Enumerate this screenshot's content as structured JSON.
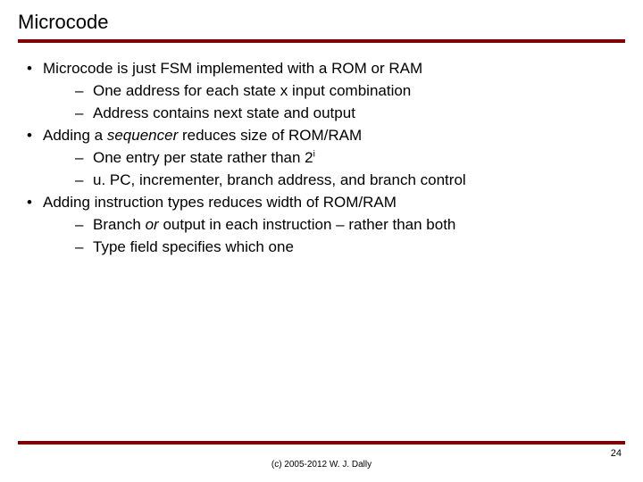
{
  "title": "Microcode",
  "bullets": {
    "b1": "Microcode is just FSM implemented with a ROM or RAM",
    "b1a": "One address for each state x input combination",
    "b1b": "Address contains next state and output",
    "b2_pre": "Adding a ",
    "b2_it": "sequencer",
    "b2_post": " reduces size of ROM/RAM",
    "b2a_pre": "One entry per state rather than 2",
    "b2a_sup": "i",
    "b2b": "u. PC, incrementer, branch address, and branch control",
    "b3": "Adding instruction types reduces width of ROM/RAM",
    "b3a_pre": "Branch ",
    "b3a_it": "or",
    "b3a_post": " output in each instruction – rather than both",
    "b3b": "Type field specifies which one"
  },
  "footer": {
    "copyright": "(c) 2005-2012 W. J. Dally",
    "page": "24"
  }
}
